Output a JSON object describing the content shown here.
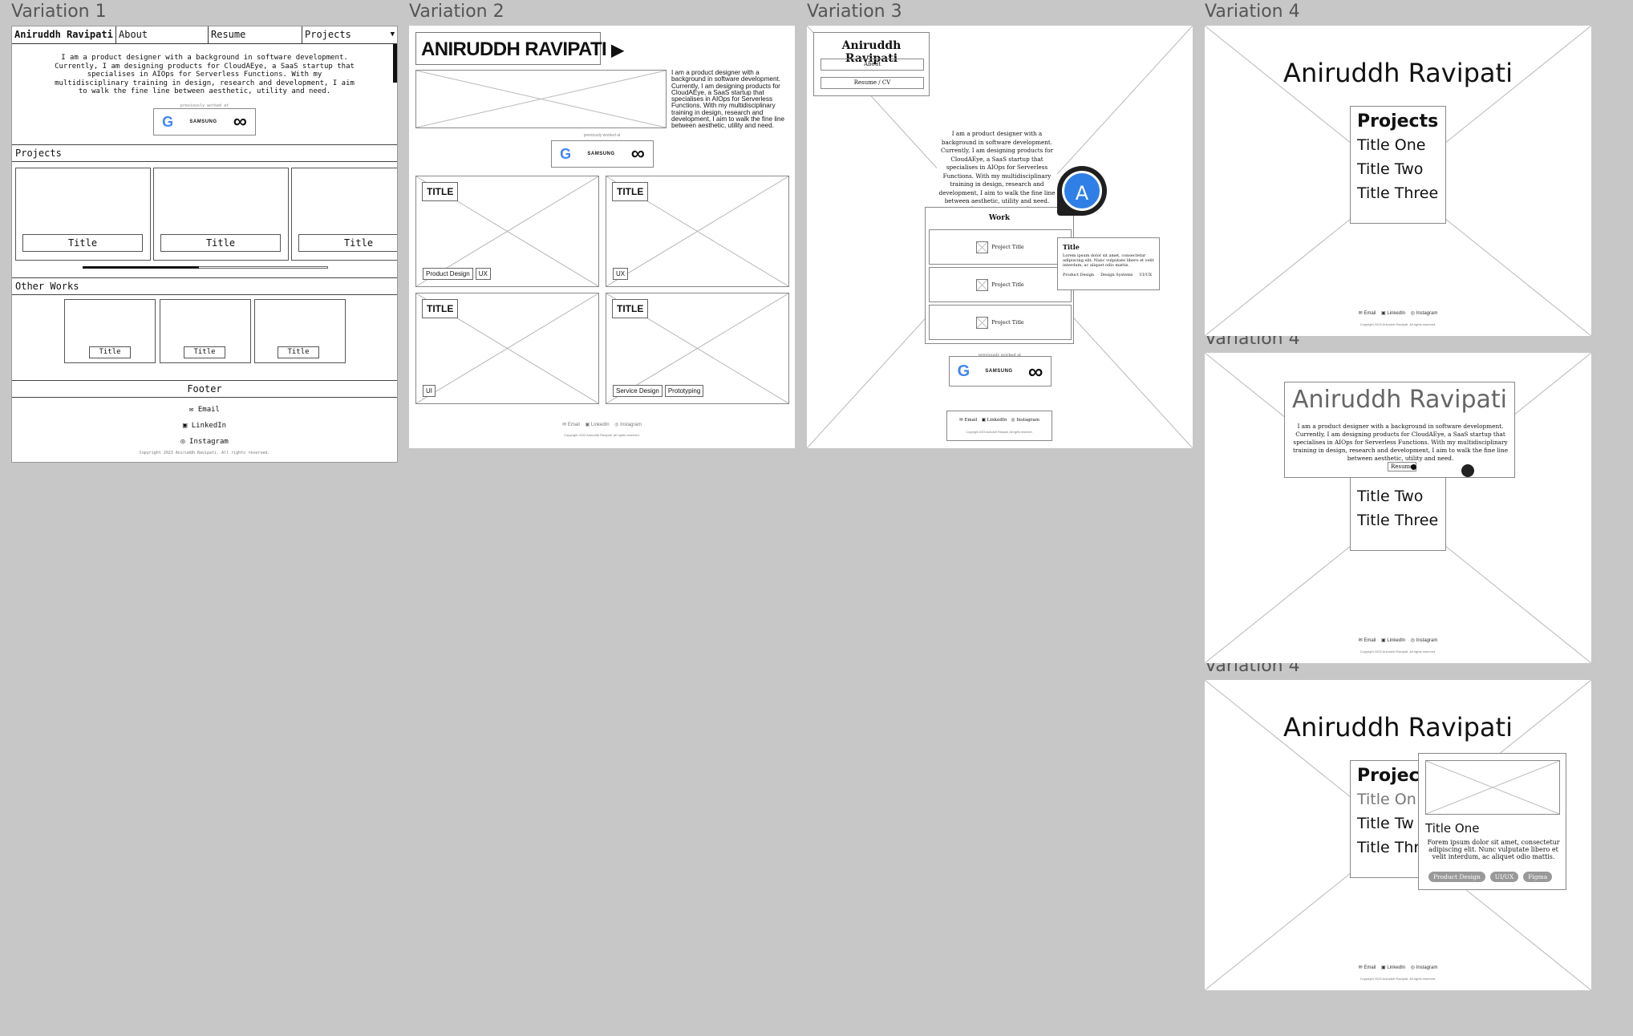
{
  "labels": {
    "v1": "Variation 1",
    "v2": "Variation 2",
    "v3": "Variation 3",
    "v4a": "Variation 4",
    "v4b": "Variation 4",
    "v4c": "Variation 4"
  },
  "common": {
    "name": "Aniruddh Ravipati",
    "name_upper": "ANIRUDDH RAVIPATI",
    "bio": "I am a product designer with a background in software development. Currently, I am designing products for CloudAEye, a SaaS startup that specialises in AIOps for Serverless Functions. With my multidisciplinary training in design, research and development, I aim to walk the fine line between aesthetic, utility and need.",
    "previously": "previously worked at",
    "logos": {
      "google": "G",
      "samsung": "SAMSUNG",
      "meta": "∞"
    },
    "footer_links": {
      "email": "Email",
      "linkedin": "LinkedIn",
      "instagram": "Instagram"
    },
    "copyright": "Copyright 2023 Aniruddh Ravipati. All rights reserved."
  },
  "v1": {
    "nav": {
      "brand": "Aniruddh Ravipati",
      "about": "About",
      "resume": "Resume",
      "projects": "Projects",
      "chevron": "▼"
    },
    "projects_heading": "Projects",
    "project_titles": [
      "Title",
      "Title",
      "Title"
    ],
    "other_heading": "Other Works",
    "other_titles": [
      "Title",
      "Title",
      "Title"
    ],
    "footer_heading": "Footer",
    "copyright": "Copyright 2023 Aniruddh Ravipati. All rights reserved."
  },
  "v2": {
    "arrow": "▶",
    "cards": [
      {
        "title": "TITLE",
        "tags": [
          "Product Design",
          "UX"
        ]
      },
      {
        "title": "TITLE",
        "tags": [
          "UX"
        ]
      },
      {
        "title": "TITLE",
        "tags": [
          "UI"
        ]
      },
      {
        "title": "TITLE",
        "tags": [
          "Service Design",
          "Prototyping"
        ]
      }
    ]
  },
  "v3": {
    "nav_about": "About",
    "nav_resume": "Resume / CV",
    "work_heading": "Work",
    "projects": [
      "Project Title",
      "Project Title",
      "Project Title"
    ],
    "popup": {
      "title": "Title",
      "desc": "Lorem ipsum dolor sit amet, consectetur adipiscing elit. Nunc vulputate libero et velit interdum, ac aliquet odio mattis.",
      "tags": [
        "Product Design",
        "Design Systems",
        "UI/UX"
      ]
    },
    "avatar_letter": "A"
  },
  "v4": {
    "projects_heading": "Projects",
    "items": [
      "Title One",
      "Title Two",
      "Title Three"
    ],
    "resume": "Resume",
    "list_c_heading": "Projec",
    "list_c_items": [
      "Title On",
      "Title Tw",
      "Title Thr"
    ],
    "popup": {
      "title": "Title One",
      "desc": "Forem ipsum dolor sit amet, consectetur adipiscing elit. Nunc vulputate libero et velit interdum, ac aliquet odio mattis.",
      "tags": [
        "Product Design",
        "UI/UX",
        "Figma"
      ]
    }
  }
}
